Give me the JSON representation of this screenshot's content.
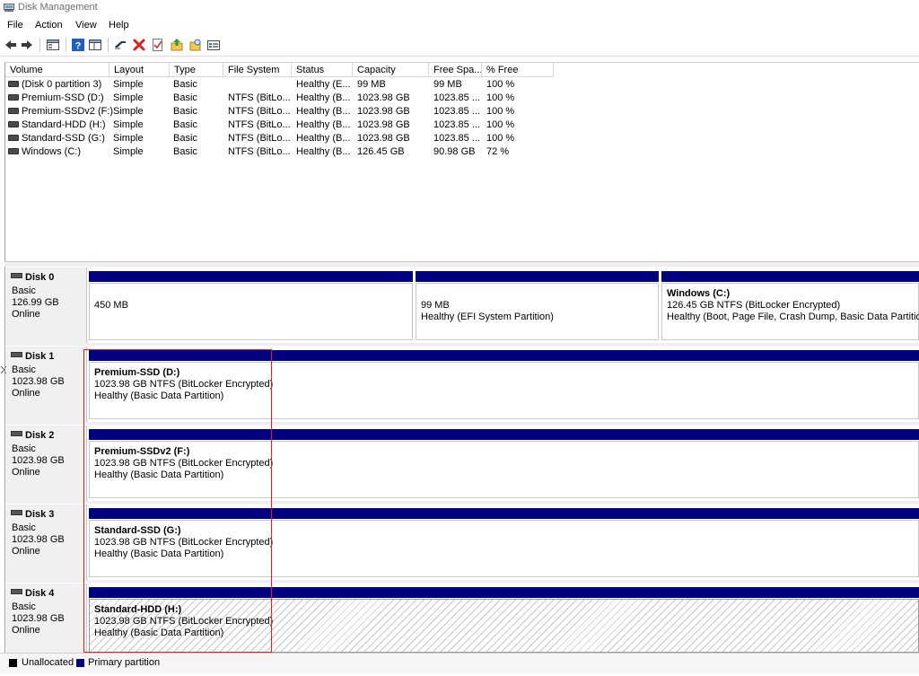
{
  "window": {
    "title": "Disk Management"
  },
  "menu": [
    "File",
    "Action",
    "View",
    "Help"
  ],
  "toolbar": {
    "buttons": [
      "back-icon",
      "forward-icon",
      "properties-icon",
      "help-icon",
      "view-icon",
      "connect-icon",
      "delete-icon",
      "check-icon",
      "up-icon",
      "search-icon",
      "list-icon"
    ]
  },
  "volumes": {
    "columns": [
      "Volume",
      "Layout",
      "Type",
      "File System",
      "Status",
      "Capacity",
      "Free Spa...",
      "% Free"
    ],
    "rows": [
      [
        "(Disk 0 partition 3)",
        "Simple",
        "Basic",
        "",
        "Healthy (E...",
        "99 MB",
        "99 MB",
        "100 %"
      ],
      [
        "Premium-SSD (D:)",
        "Simple",
        "Basic",
        "NTFS (BitLo...",
        "Healthy (B...",
        "1023.98 GB",
        "1023.85 ...",
        "100 %"
      ],
      [
        "Premium-SSDv2 (F:)",
        "Simple",
        "Basic",
        "NTFS (BitLo...",
        "Healthy (B...",
        "1023.98 GB",
        "1023.85 ...",
        "100 %"
      ],
      [
        "Standard-HDD (H:)",
        "Simple",
        "Basic",
        "NTFS (BitLo...",
        "Healthy (B...",
        "1023.98 GB",
        "1023.85 ...",
        "100 %"
      ],
      [
        "Standard-SSD (G:)",
        "Simple",
        "Basic",
        "NTFS (BitLo...",
        "Healthy (B...",
        "1023.98 GB",
        "1023.85 ...",
        "100 %"
      ],
      [
        "Windows (C:)",
        "Simple",
        "Basic",
        "NTFS (BitLo...",
        "Healthy (B...",
        "126.45 GB",
        "90.98 GB",
        "72 %"
      ]
    ]
  },
  "disks": [
    {
      "name": "Disk 0",
      "type": "Basic",
      "size": "126.99 GB",
      "state": "Online",
      "partitions": [
        {
          "name": "",
          "line1": "450 MB",
          "line2": ""
        },
        {
          "name": "",
          "line1": "99 MB",
          "line2": "Healthy (EFI System Partition)"
        },
        {
          "name": "Windows  (C:)",
          "line1": "126.45 GB NTFS (BitLocker Encrypted)",
          "line2": "Healthy (Boot, Page File, Crash Dump, Basic Data Partition)"
        }
      ]
    },
    {
      "name": "Disk 1",
      "type": "Basic",
      "size": "1023.98 GB",
      "state": "Online",
      "partitions": [
        {
          "name": "Premium-SSD  (D:)",
          "line1": "1023.98 GB NTFS (BitLocker Encrypted)",
          "line2": "Healthy (Basic Data Partition)"
        }
      ]
    },
    {
      "name": "Disk 2",
      "type": "Basic",
      "size": "1023.98 GB",
      "state": "Online",
      "partitions": [
        {
          "name": "Premium-SSDv2  (F:)",
          "line1": "1023.98 GB NTFS (BitLocker Encrypted)",
          "line2": "Healthy (Basic Data Partition)"
        }
      ]
    },
    {
      "name": "Disk 3",
      "type": "Basic",
      "size": "1023.98 GB",
      "state": "Online",
      "partitions": [
        {
          "name": "Standard-SSD  (G:)",
          "line1": "1023.98 GB NTFS (BitLocker Encrypted)",
          "line2": "Healthy (Basic Data Partition)"
        }
      ]
    },
    {
      "name": "Disk 4",
      "type": "Basic",
      "size": "1023.98 GB",
      "state": "Online",
      "partitions": [
        {
          "name": "Standard-HDD  (H:)",
          "line1": "1023.98 GB NTFS (BitLocker Encrypted)",
          "line2": "Healthy (Basic Data Partition)"
        }
      ]
    }
  ],
  "legend": {
    "unallocated": "Unallocated",
    "primary": "Primary partition"
  },
  "colors": {
    "primary_partition": "#000080",
    "unallocated": "#000000",
    "highlight_box": "#e02020"
  }
}
